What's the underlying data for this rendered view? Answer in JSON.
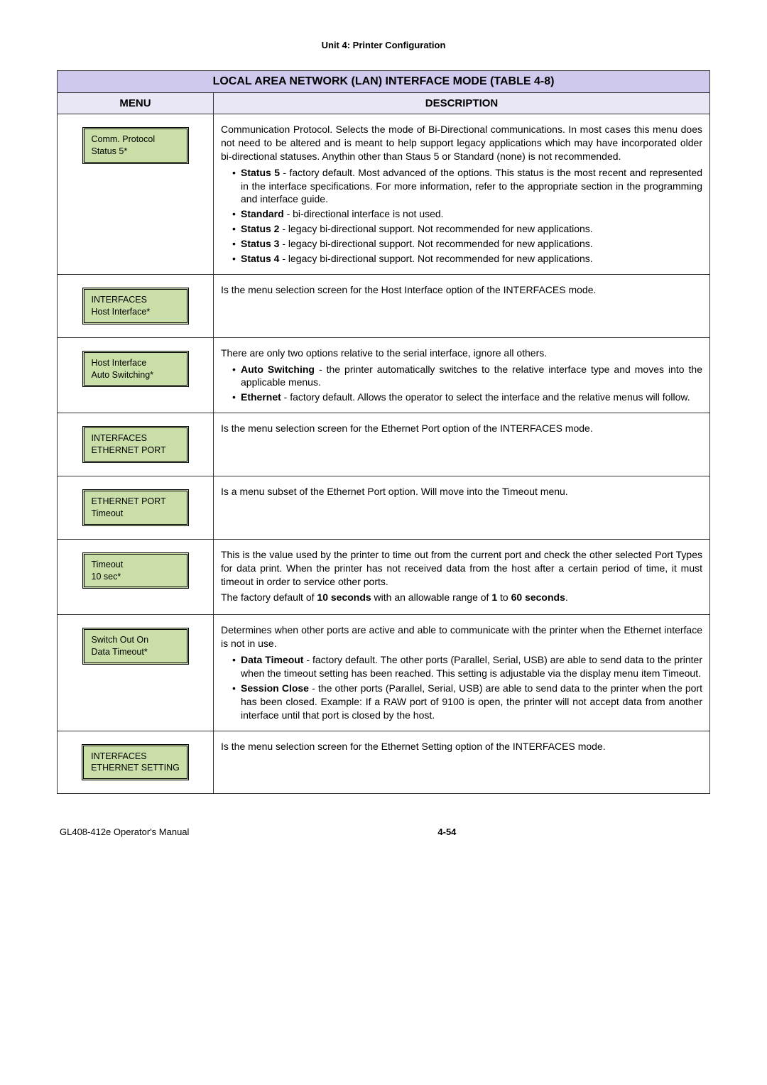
{
  "unit_header": "Unit 4:  Printer Configuration",
  "table_title": "LOCAL AREA NETWORK (LAN) INTERFACE MODE (TABLE 4-8)",
  "col_menu": "MENU",
  "col_desc": "DESCRIPTION",
  "rows": [
    {
      "lcd1": "Comm. Protocol",
      "lcd2": "Status 5*",
      "intro": "Communication Protocol. Selects the mode of Bi-Directional communications. In most cases this menu does not need to be altered and is meant to help support legacy applications which may have incorporated older bi-directional statuses. Anythin other than Staus 5 or Standard (none) is not recommended.",
      "items": [
        {
          "b": "Status 5",
          "t": " - factory default. Most advanced of the options. This status is the most recent and represented in the interface specifications. For more information, refer to the appropriate section in the programming and interface guide."
        },
        {
          "b": "Standard",
          "t": " - bi-directional interface is not used."
        },
        {
          "b": "Status 2",
          "t": " - legacy bi-directional support. Not recommended for new applications."
        },
        {
          "b": "Status 3",
          "t": " - legacy bi-directional support. Not recommended for new applications."
        },
        {
          "b": "Status 4",
          "t": " - legacy bi-directional support. Not recommended for new applications."
        }
      ]
    },
    {
      "lcd1": "INTERFACES",
      "lcd2": "Host Interface*",
      "intro": "Is the menu selection screen for the Host Interface option of the INTERFACES mode."
    },
    {
      "lcd1": "Host Interface",
      "lcd2": "Auto Switching*",
      "intro": "There are only two options relative to the serial interface, ignore all others.",
      "items": [
        {
          "b": "Auto Switching",
          "t": " - the printer automatically switches to the relative interface type and moves into the applicable menus."
        },
        {
          "b": "Ethernet",
          "t": " - factory default. Allows the operator to select the interface and the relative menus will follow."
        }
      ]
    },
    {
      "lcd1": "INTERFACES",
      "lcd2": "ETHERNET PORT",
      "intro": "Is the menu selection screen for the Ethernet Port option of the INTERFACES mode."
    },
    {
      "lcd1": "ETHERNET PORT",
      "lcd2": "Timeout",
      "intro": "Is a menu subset of the Ethernet Port option. Will move into the Timeout menu."
    },
    {
      "lcd1": "Timeout",
      "lcd2": "10  sec*",
      "intro": "This is the value used by the printer to time out from the current port and check the other selected Port Types for data print. When the printer has not received data from the host after a certain period of time, it must timeout in order to service other ports.",
      "outro_pre": "The factory default of ",
      "outro_b1": "10 seconds",
      "outro_mid": " with an allowable range of ",
      "outro_b2": "1",
      "outro_mid2": " to ",
      "outro_b3": "60 seconds",
      "outro_post": "."
    },
    {
      "lcd1": "Switch Out On",
      "lcd2": "Data Timeout*",
      "intro": "Determines when other ports are active and able to communicate with the printer when the Ethernet interface is not in use.",
      "items": [
        {
          "b": "Data Timeout",
          "t": " -  factory default. The other ports (Parallel, Serial, USB) are able to send data to the printer when the timeout setting has been reached. This setting is adjustable via the display menu item Timeout."
        },
        {
          "b": "Session Close",
          "t": " - the other ports (Parallel, Serial, USB) are able to send data to the printer when the port has been closed. Example: If a RAW port of 9100 is open, the printer will not accept data from another interface until that port is closed by the host."
        }
      ]
    },
    {
      "lcd1": "INTERFACES",
      "lcd2": "ETHERNET SETTING",
      "intro": "Is the menu selection screen for the Ethernet Setting option of the INTERFACES mode."
    }
  ],
  "footer_left": "GL408-412e Operator's Manual",
  "footer_page": "4-54"
}
